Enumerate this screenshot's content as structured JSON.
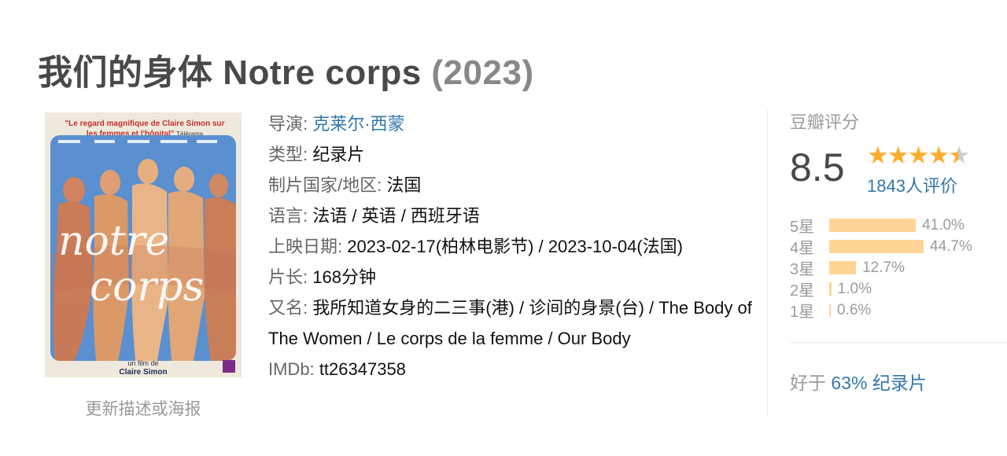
{
  "movie": {
    "title": "我们的身体 Notre corps",
    "year": "(2023)"
  },
  "poster": {
    "quote": "\"Le regard magnifique de Claire Simon sur les femmes et l'hôpital\"",
    "quote_source": "Télérama",
    "art_text": "notre corps",
    "byline": "un film de",
    "director": "Claire Simon",
    "update_link": "更新描述或海报"
  },
  "info": {
    "director_label": "导演:",
    "director": "克莱尔·西蒙",
    "genre_label": "类型:",
    "genre": "纪录片",
    "country_label": "制片国家/地区:",
    "country": "法国",
    "language_label": "语言:",
    "language": "法语 / 英语 / 西班牙语",
    "release_label": "上映日期:",
    "release": "2023-02-17(柏林电影节) / 2023-10-04(法国)",
    "runtime_label": "片长:",
    "runtime": "168分钟",
    "aka_label": "又名:",
    "aka": "我所知道女身的二三事(港) / 诊间的身景(台) / The Body of The Women / Le corps de la femme / Our Body",
    "imdb_label": "IMDb:",
    "imdb": "tt26347358"
  },
  "rating": {
    "title": "豆瓣评分",
    "score": "8.5",
    "stars": 4.5,
    "star_color": "#ffac2d",
    "votes": "1843人评价",
    "distribution": [
      {
        "label": "5星",
        "percent": 41.0,
        "text": "41.0%"
      },
      {
        "label": "4星",
        "percent": 44.7,
        "text": "44.7%"
      },
      {
        "label": "3星",
        "percent": 12.7,
        "text": "12.7%"
      },
      {
        "label": "2星",
        "percent": 1.0,
        "text": "1.0%"
      },
      {
        "label": "1星",
        "percent": 0.6,
        "text": "0.6%"
      }
    ],
    "better_prefix": "好于",
    "better_pct": "63%",
    "better_genre": "纪录片"
  },
  "colors": {
    "link": "#3377aa",
    "bar": "#ffd596",
    "label_gray": "#9b9b9b"
  }
}
